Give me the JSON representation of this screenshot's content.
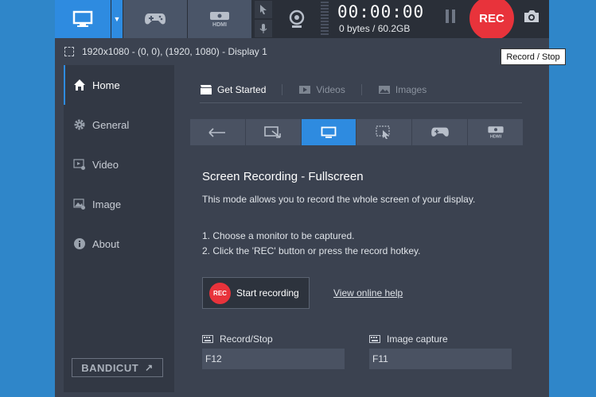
{
  "toolbar": {
    "timer": "00:00:00",
    "size": "0 bytes / 60.2GB",
    "rec_label": "REC"
  },
  "infobar": {
    "capture_area": "1920x1080 - (0, 0), (1920, 1080) - Display 1"
  },
  "tooltip": "Record / Stop",
  "sidebar": {
    "items": [
      {
        "label": "Home",
        "icon": "home-icon"
      },
      {
        "label": "General",
        "icon": "gear-icon"
      },
      {
        "label": "Video",
        "icon": "video-settings-icon"
      },
      {
        "label": "Image",
        "icon": "image-settings-icon"
      },
      {
        "label": "About",
        "icon": "info-icon"
      }
    ],
    "bandicut": "BANDICUT"
  },
  "tabs": [
    {
      "label": "Get Started"
    },
    {
      "label": "Videos"
    },
    {
      "label": "Images"
    }
  ],
  "main": {
    "heading": "Screen Recording - Fullscreen",
    "description": "This mode allows you to record the whole screen of your display.",
    "step1": "1. Choose a monitor to be captured.",
    "step2": "2. Click the 'REC' button or press the record hotkey.",
    "start_rec_icon": "REC",
    "start_label": "Start recording",
    "help_link": "View online help",
    "hotkeys": [
      {
        "label": "Record/Stop",
        "value": "F12"
      },
      {
        "label": "Image capture",
        "value": "F11"
      }
    ]
  },
  "colors": {
    "accent": "#2e8be0",
    "rec": "#e8333b",
    "desktop": "#2f86c9"
  }
}
